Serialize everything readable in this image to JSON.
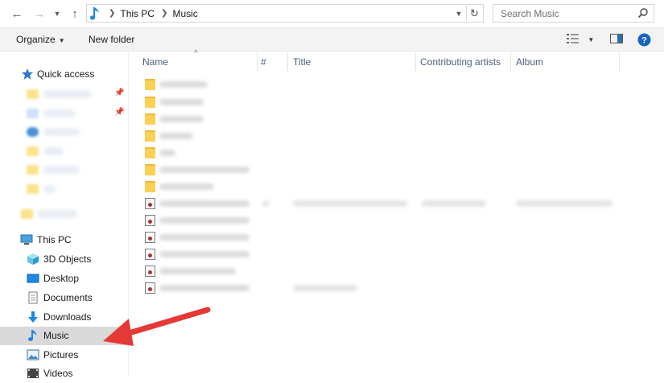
{
  "window": {
    "breadcrumb": [
      "This PC",
      "Music"
    ],
    "search_placeholder": "Search Music"
  },
  "toolbar": {
    "organize_label": "Organize",
    "new_folder_label": "New folder"
  },
  "nav": {
    "quick_access": "Quick access",
    "this_pc": "This PC",
    "items": [
      {
        "label": "3D Objects",
        "icon": "3d-objects-icon"
      },
      {
        "label": "Desktop",
        "icon": "desktop-icon"
      },
      {
        "label": "Documents",
        "icon": "documents-icon"
      },
      {
        "label": "Downloads",
        "icon": "downloads-icon"
      },
      {
        "label": "Music",
        "icon": "music-icon"
      },
      {
        "label": "Pictures",
        "icon": "pictures-icon"
      },
      {
        "label": "Videos",
        "icon": "videos-icon"
      }
    ],
    "selected": "Music"
  },
  "columns": [
    "Name",
    "#",
    "Title",
    "Contributing artists",
    "Album"
  ],
  "colors": {
    "accent": "#1e88e5",
    "selected_bg": "#d9d9d9",
    "arrow": "#e53935",
    "folder": "#fccf55"
  }
}
